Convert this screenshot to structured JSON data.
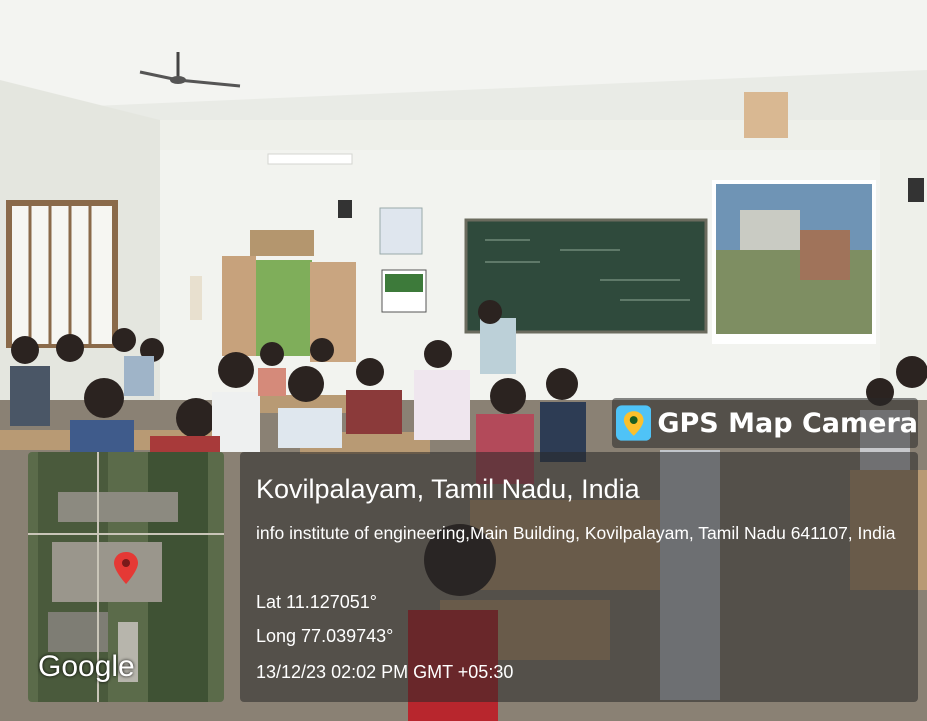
{
  "badge": {
    "app_title": "GPS Map Camera",
    "icon": "map-pin-icon"
  },
  "map": {
    "provider_logo": "Google",
    "marker_icon": "map-marker-icon"
  },
  "location": {
    "place": "Kovilpalayam, Tamil Nadu, India",
    "address": "info institute of engineering,Main Building, Kovilpalayam, Tamil Nadu 641107, India",
    "latitude": "Lat 11.127051°",
    "longitude": "Long 77.039743°",
    "datetime": "13/12/23 02:02 PM GMT +05:30"
  },
  "colors": {
    "overlay": "#282828",
    "marker": "#e53935",
    "board": "#2f4a3c",
    "wall": "#eef0ea"
  }
}
